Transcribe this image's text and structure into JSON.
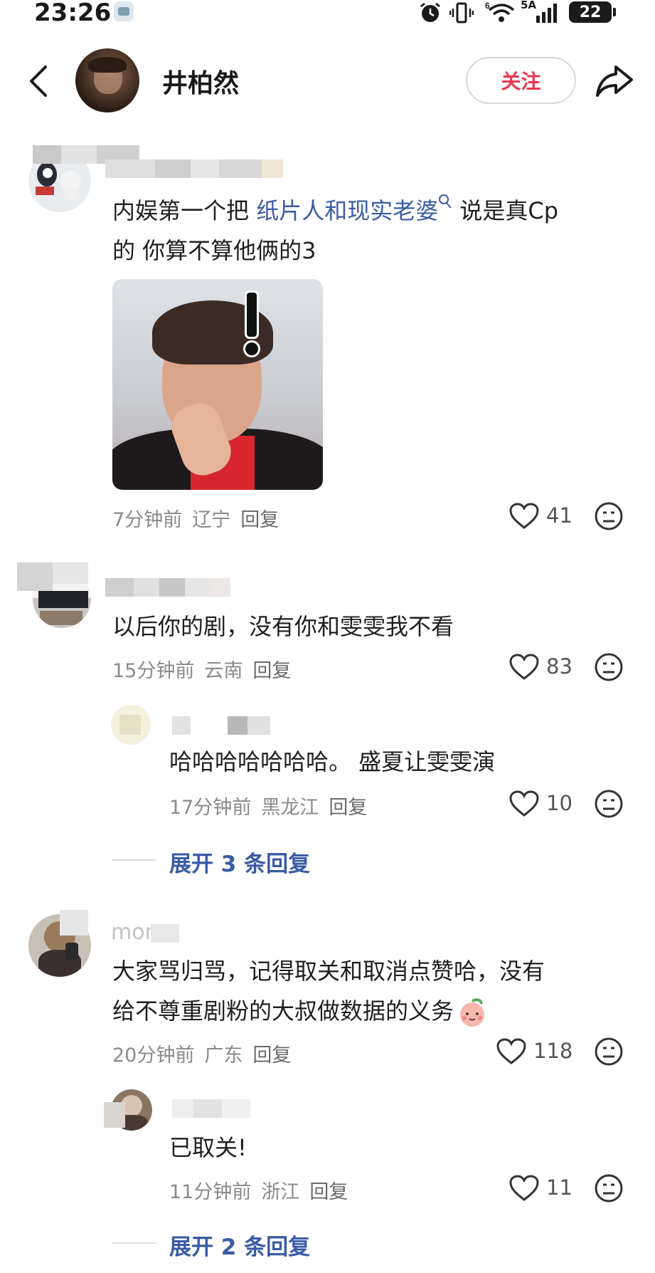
{
  "status_bar": {
    "time": "23:26",
    "network_label": "5A",
    "battery": "22"
  },
  "header": {
    "username": "井柏然",
    "follow_label": "关注"
  },
  "comments": [
    {
      "text_prefix": "内娱第一个把 ",
      "link": "纸片人和现实老婆",
      "text_suffix": " 说是真Cp",
      "text_line2": "的 你算不算他俩的3",
      "time": "7分钟前",
      "location": "辽宁",
      "reply": "回复",
      "likes": "41"
    },
    {
      "text": "以后你的剧，没有你和雯雯我不看",
      "time": "15分钟前",
      "location": "云南",
      "reply": "回复",
      "likes": "83",
      "sub_reply": {
        "text": "哈哈哈哈哈哈哈。 盛夏让雯雯演",
        "time": "17分钟前",
        "location": "黑龙江",
        "reply": "回复",
        "likes": "10"
      },
      "expand_label": "展开 3 条回复"
    },
    {
      "username_partial": "mom",
      "text_line1": "大家骂归骂，记得取关和取消点赞哈，没有",
      "text_line2": "给不尊重剧粉的大叔做数据的义务",
      "time": "20分钟前",
      "location": "广东",
      "reply": "回复",
      "likes": "118",
      "sub_reply": {
        "text": "已取关!",
        "time": "11分钟前",
        "location": "浙江",
        "reply": "回复",
        "likes": "11"
      },
      "expand_label": "展开 2 条回复"
    }
  ],
  "icons": {
    "back": "back-arrow-icon",
    "share": "share-icon",
    "like": "heart-icon",
    "reaction": "neutral-face-icon",
    "search": "search-icon"
  },
  "colors": {
    "follow": "#e8384f",
    "link": "#3b5ba5",
    "meta": "#8a8a8a"
  }
}
